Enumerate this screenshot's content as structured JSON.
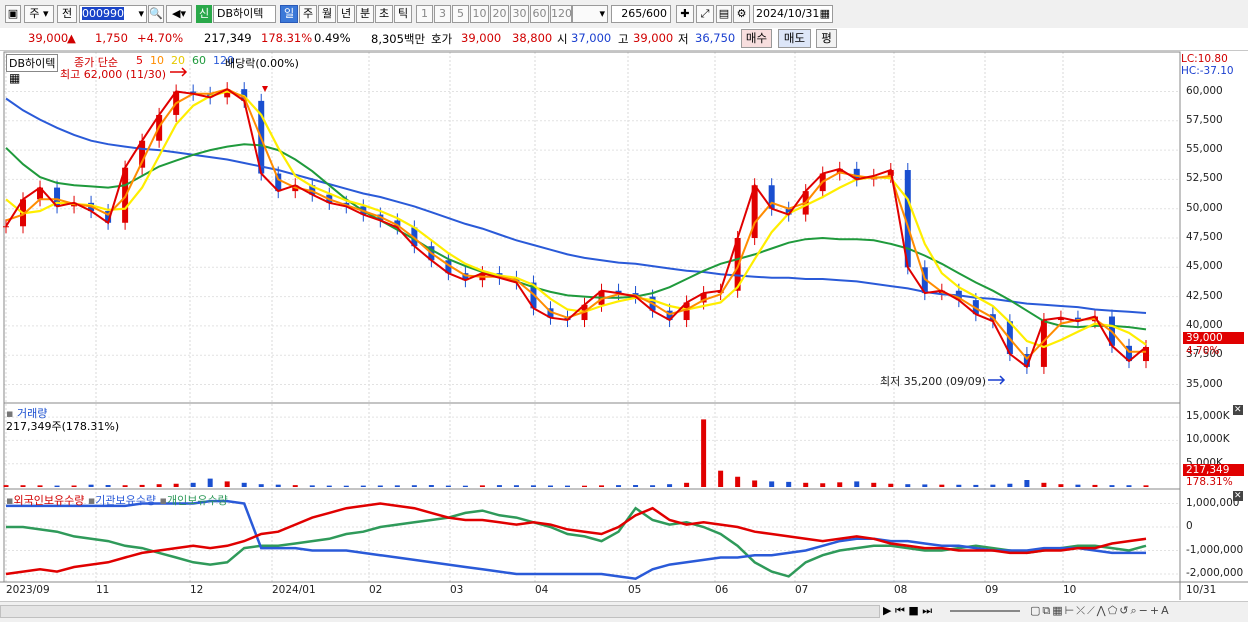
{
  "toolbar": {
    "market_label": "주",
    "type_label": "전",
    "code": "000990",
    "new_badge": "신",
    "stock_name": "DB하이텍",
    "periods": [
      "일",
      "주",
      "월",
      "년",
      "분",
      "초",
      "틱"
    ],
    "intervals": [
      "1",
      "3",
      "5",
      "10",
      "20",
      "30",
      "60",
      "120"
    ],
    "count": "265",
    "count_total": "/600",
    "date": "2024/10/31"
  },
  "quote": {
    "price": "39,000",
    "change": "1,750",
    "change_pct": "+4.70%",
    "volume": "217,349",
    "volume_ratio": "178.31%",
    "turnover": "0.49%",
    "amount": "8,305백만",
    "ask_label": "호가",
    "ask": "39,000",
    "bid": "38,800",
    "open_label": "시",
    "open": "37,000",
    "high_label": "고",
    "high": "39,000",
    "low_label": "저",
    "low": "36,750",
    "buy_button": "매수",
    "sell_button": "매도",
    "avg_button": "평"
  },
  "price_pane": {
    "name_tag": "DB하이텍",
    "ma_label": "종가 단순",
    "ma_periods": [
      "5",
      "10",
      "20",
      "60",
      "120"
    ],
    "dividend_label": "배당락(0.00%)",
    "high_label": "최고 62,000 (11/30)",
    "low_label": "최저 35,200 (09/09)",
    "lc_label": "LC:10.80",
    "hc_label": "HC:-37.10",
    "price_tag": "39,000",
    "pct_tag": "4.70%",
    "y_ticks": [
      "60,000",
      "57,500",
      "55,000",
      "52,500",
      "50,000",
      "47,500",
      "45,000",
      "42,500",
      "40,000",
      "37,500",
      "35,000"
    ]
  },
  "volume_pane": {
    "title": "거래량",
    "value_label": "217,349주(178.31%)",
    "y_ticks": [
      "15,000K",
      "10,000K",
      "5,000K"
    ],
    "tag_value": "217,349",
    "tag_pct": "178.31%"
  },
  "holding_pane": {
    "foreign_label": "외국인보유수량",
    "inst_label": "기관보유수량",
    "indiv_label": "개인보유수량",
    "y_ticks": [
      "1,000,000",
      "0",
      "-1,000,000",
      "-2,000,000"
    ]
  },
  "x_axis": [
    "2023/09",
    "11",
    "12",
    "2024/01",
    "02",
    "03",
    "04",
    "05",
    "06",
    "07",
    "08",
    "09",
    "10",
    "10/31"
  ],
  "colors": {
    "ma5": "#e00000",
    "ma10": "#ff8c00",
    "ma20": "#ffee00",
    "ma60": "#1f9a3c",
    "ma120": "#2a5ad8",
    "up": "#e00000",
    "down": "#1a4fd0",
    "foreign": "#e00000",
    "inst": "#2a5ad8",
    "indiv": "#2f9a5a"
  },
  "chart_data": {
    "type": "line",
    "title": "DB하이텍",
    "ylim": [
      34000,
      63000
    ],
    "series": [
      {
        "name": "5",
        "values": [
          48500,
          50800,
          51800,
          50200,
          50500,
          49800,
          48800,
          53500,
          55800,
          58000,
          60000,
          59800,
          59500,
          60200,
          59200,
          53000,
          51500,
          52000,
          51200,
          50500,
          50200,
          49500,
          49000,
          48400,
          46800,
          45600,
          44500,
          43900,
          44500,
          44100,
          43700,
          41500,
          40700,
          40500,
          41800,
          43000,
          42800,
          42500,
          41300,
          40500,
          42000,
          42800,
          43000,
          47500,
          52000,
          50000,
          49500,
          51500,
          53000,
          53400,
          52500,
          52800,
          53300,
          45000,
          42800,
          43000,
          42200,
          41000,
          40400,
          37600,
          36500,
          40500,
          40700,
          40400,
          40800,
          38300,
          37000,
          38200
        ]
      },
      {
        "name": "10",
        "values": [
          49000,
          49500,
          50800,
          50800,
          50400,
          50200,
          49500,
          51000,
          54000,
          57000,
          59000,
          59800,
          59800,
          60200,
          59500,
          56000,
          52500,
          51800,
          51500,
          50800,
          50300,
          49800,
          49300,
          48600,
          47500,
          46200,
          45200,
          44300,
          44200,
          44200,
          43900,
          42700,
          41200,
          40700,
          41200,
          42300,
          42700,
          42600,
          41900,
          41000,
          41400,
          42200,
          42700,
          45000,
          48800,
          50500,
          50000,
          50500,
          52300,
          53100,
          52800,
          52600,
          52800,
          48500,
          44000,
          42900,
          42400,
          41500,
          40700,
          38900,
          37200,
          38700,
          40200,
          40500,
          40600,
          39500,
          37800,
          37800
        ]
      },
      {
        "name": "20",
        "values": [
          50800,
          49600,
          49800,
          50500,
          50400,
          50300,
          49900,
          50000,
          51800,
          54500,
          57200,
          58800,
          59600,
          60000,
          59600,
          58000,
          55200,
          52800,
          51900,
          51300,
          50700,
          50300,
          49800,
          49200,
          48400,
          47300,
          46200,
          45300,
          44700,
          44300,
          44100,
          43500,
          42300,
          41400,
          41200,
          41700,
          42100,
          42400,
          42200,
          41700,
          41400,
          41700,
          42000,
          43300,
          45700,
          48000,
          49600,
          50300,
          51000,
          51800,
          52500,
          52700,
          52600,
          50800,
          47000,
          44500,
          43300,
          42500,
          41700,
          40300,
          38700,
          38200,
          38800,
          39500,
          40200,
          40000,
          39400,
          38400
        ]
      },
      {
        "name": "60",
        "values": [
          55200,
          53800,
          52700,
          52200,
          52000,
          51900,
          51800,
          52000,
          52800,
          53600,
          54100,
          54600,
          55000,
          55300,
          55500,
          55400,
          55000,
          54200,
          53200,
          52000,
          50800,
          49800,
          49000,
          48200,
          47400,
          46500,
          45700,
          45100,
          44600,
          44200,
          43800,
          43300,
          42900,
          42600,
          42500,
          42400,
          42400,
          42500,
          42800,
          43300,
          44000,
          44700,
          45300,
          45700,
          46100,
          46600,
          47100,
          47400,
          47500,
          47400,
          47400,
          47300,
          47000,
          46600,
          46000,
          45300,
          44500,
          43700,
          43000,
          42200,
          41300,
          40400,
          40000,
          39900,
          40000,
          40000,
          39900,
          39700
        ]
      },
      {
        "name": "120",
        "values": [
          59400,
          58400,
          57600,
          56900,
          56300,
          55800,
          55500,
          55300,
          55100,
          55000,
          54800,
          54600,
          54400,
          54200,
          53900,
          53600,
          53300,
          52900,
          52500,
          52100,
          51700,
          51300,
          51000,
          50600,
          50200,
          49700,
          49200,
          48700,
          48300,
          47800,
          47300,
          46900,
          46500,
          46100,
          45800,
          45600,
          45400,
          45300,
          45100,
          44900,
          44700,
          44600,
          44400,
          44300,
          44200,
          44100,
          44100,
          44000,
          44000,
          43900,
          43800,
          43600,
          43400,
          43200,
          42900,
          42700,
          42600,
          42400,
          42300,
          42100,
          41900,
          41800,
          41700,
          41600,
          41400,
          41300,
          41200,
          41100
        ]
      }
    ],
    "volume_k": [
      400,
      380,
      350,
      300,
      320,
      500,
      420,
      380,
      450,
      600,
      700,
      900,
      1800,
      1200,
      900,
      600,
      500,
      400,
      350,
      300,
      280,
      300,
      320,
      350,
      380,
      420,
      300,
      280,
      350,
      400,
      380,
      360,
      320,
      300,
      280,
      350,
      400,
      420,
      380,
      600,
      900,
      14500,
      3500,
      2200,
      1400,
      1200,
      1100,
      900,
      800,
      1000,
      1200,
      900,
      700,
      600,
      550,
      500,
      480,
      450,
      500,
      700,
      1500,
      900,
      600,
      500,
      450,
      400,
      380,
      360
    ]
  }
}
